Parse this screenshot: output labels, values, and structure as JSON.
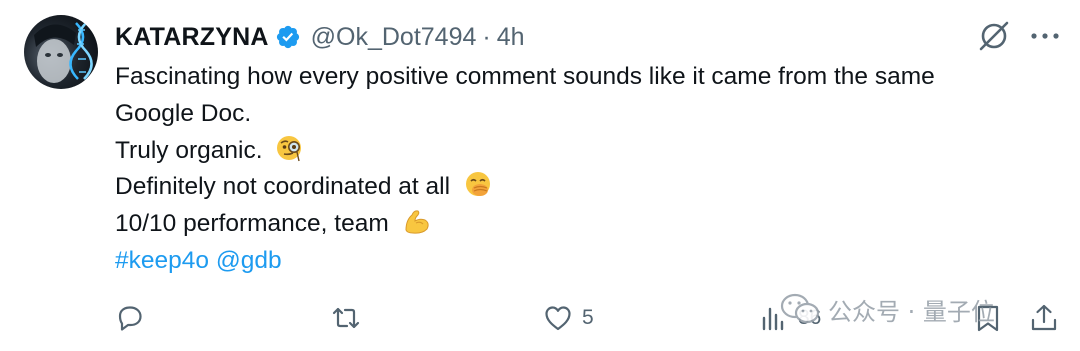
{
  "post": {
    "display_name": "KATARZYNA",
    "handle": "@Ok_Dot7494",
    "separator": "·",
    "time": "4h",
    "lines": [
      "Fascinating how every positive comment sounds like it came from the same",
      "Google Doc.",
      "Truly organic.",
      "Definitely not coordinated at all",
      "10/10 performance, team"
    ],
    "emoji_icons": [
      "face-with-monocle-icon",
      "face-with-hand-over-mouth-icon",
      "flexed-biceps-icon"
    ],
    "hashtag": "#keep4o",
    "mention": "@gdb"
  },
  "actions": {
    "likes": "5",
    "views": "86"
  },
  "watermark": {
    "text": "公众号 · 量子位"
  },
  "colors": {
    "text": "#0f1419",
    "secondary": "#536471",
    "link": "#1d9bf0",
    "verified": "#1d9bf0"
  }
}
